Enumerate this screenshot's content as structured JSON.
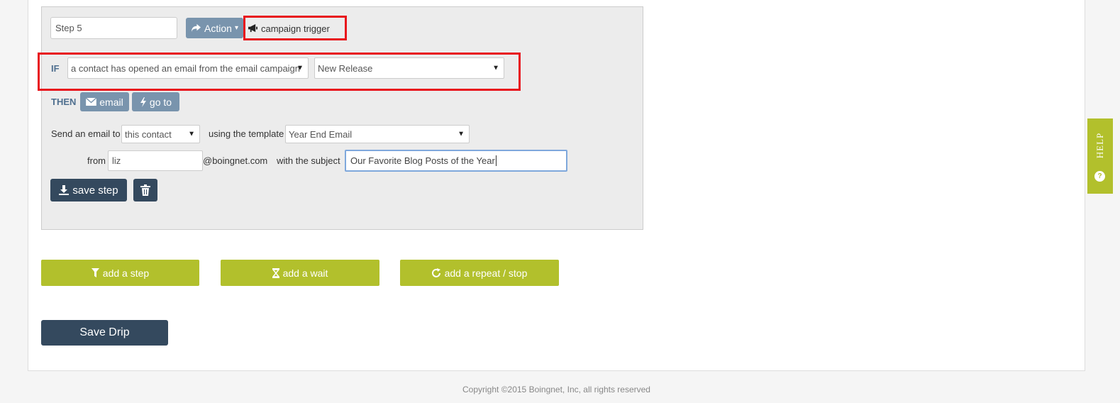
{
  "step": {
    "name_value": "Step 5",
    "action_label": "Action",
    "action_caret": "▾",
    "trigger_label": "campaign trigger"
  },
  "condition": {
    "if_label": "IF",
    "event_select": "a contact has opened an email from the email campaign",
    "campaign_select": "New Release"
  },
  "then": {
    "then_label": "THEN",
    "email_button": "email",
    "goto_button": "go to"
  },
  "email_form": {
    "send_to_label": "Send an email to",
    "recipient_select": "this contact",
    "template_label": "using the template",
    "template_select": "Year End Email",
    "from_label": "from",
    "from_value": "liz",
    "domain_text": "@boingnet.com",
    "subject_label": "with the subject",
    "subject_value": "Our Favorite Blog Posts of the Year"
  },
  "buttons": {
    "save_step": "save step",
    "add_step": "add a step",
    "add_wait": "add a wait",
    "add_repeat": "add a repeat / stop",
    "save_drip": "Save Drip"
  },
  "help": {
    "label": "HELP",
    "icon_text": "?"
  },
  "footer": {
    "copyright": "Copyright ©2015 Boingnet, Inc, all rights reserved"
  },
  "colors": {
    "accent_green": "#b2c02c",
    "dark_navy": "#34495e",
    "steel_blue": "#7994ad",
    "highlight_red": "#e8141c"
  },
  "icons": {
    "action": "share-arrow-icon",
    "trigger": "megaphone-icon",
    "email": "envelope-icon",
    "goto": "lightning-bolt-icon",
    "save": "download-icon",
    "delete": "trash-icon",
    "add_step": "filter-icon",
    "add_wait": "hourglass-icon",
    "add_repeat": "refresh-icon",
    "help": "question-circle-icon"
  }
}
